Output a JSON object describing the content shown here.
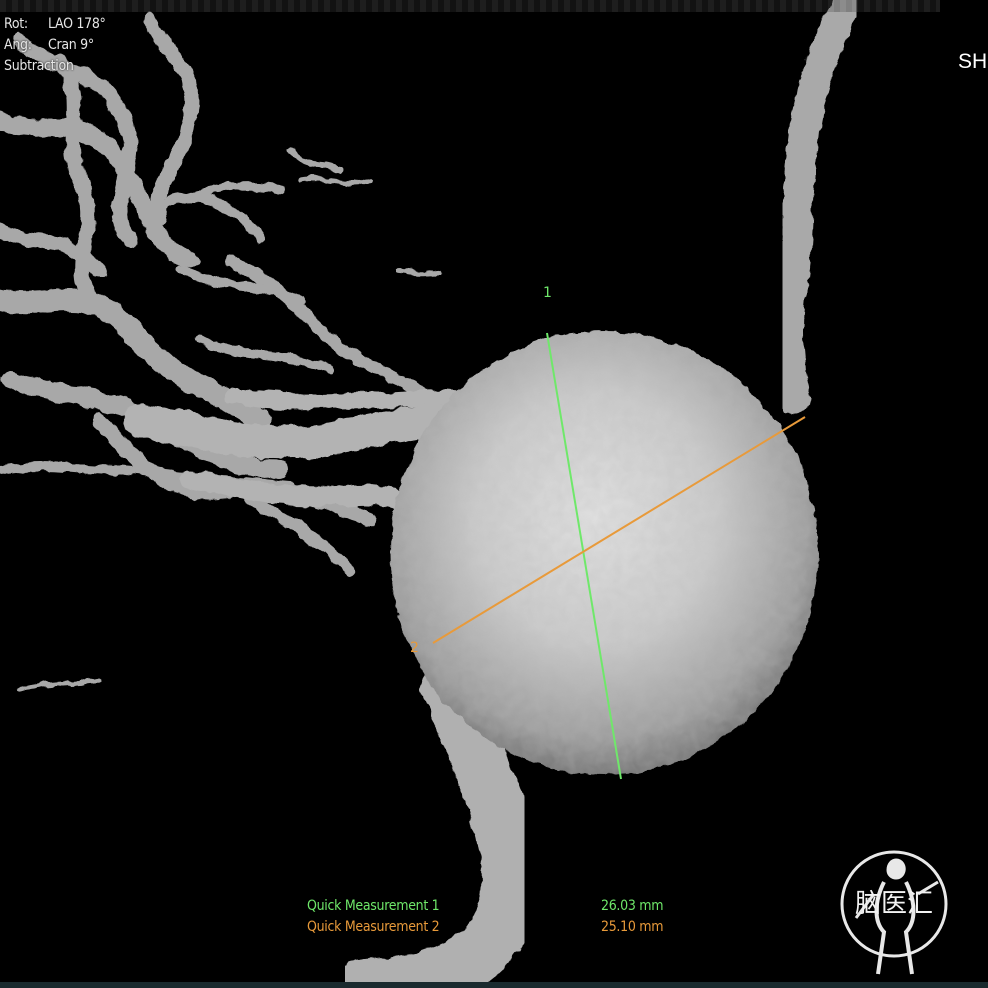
{
  "viewer": {
    "info": {
      "rot_label": "Rot:",
      "rot_value": "LAO 178°",
      "ang_label": "Ang:",
      "ang_value": "Cran 9°",
      "mode": "Subtraction"
    },
    "corner_label": "SH"
  },
  "measurements": [
    {
      "index_label": "1",
      "name": "Quick Measurement 1",
      "value": "26.03 mm",
      "color": "#6fe86a"
    },
    {
      "index_label": "2",
      "name": "Quick Measurement 2",
      "value": "25.10 mm",
      "color": "#e89a3a"
    }
  ],
  "colors": {
    "background": "#000000",
    "vessel": "#bdbdbd",
    "aneurysm": "#c9c9c9",
    "text": "#e6e6e6"
  },
  "watermark": {
    "text": "脑医汇"
  }
}
